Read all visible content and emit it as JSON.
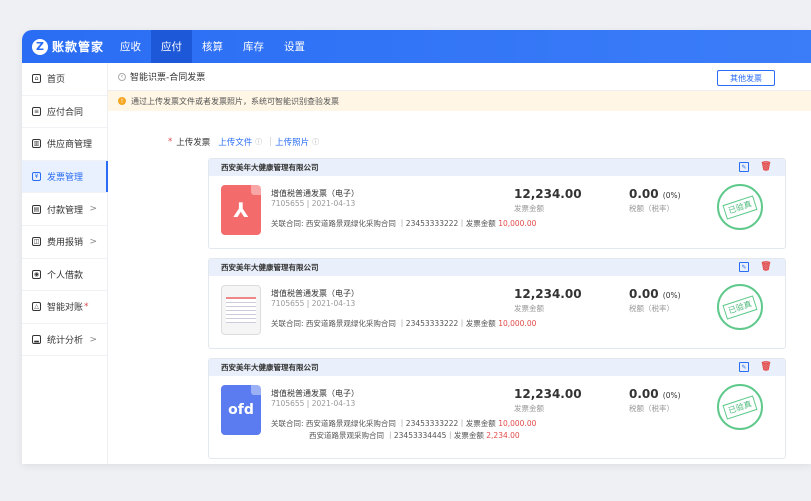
{
  "app": {
    "logo_char": "Z",
    "title": "账款管家"
  },
  "nav": [
    {
      "label": "应收",
      "active": false
    },
    {
      "label": "应付",
      "active": true
    },
    {
      "label": "核算",
      "active": false
    },
    {
      "label": "库存",
      "active": false
    },
    {
      "label": "设置",
      "active": false
    }
  ],
  "sidebar": {
    "items": [
      {
        "label": "首页",
        "icon": "home-icon"
      },
      {
        "label": "应付合同",
        "icon": "contract-icon"
      },
      {
        "label": "供应商管理",
        "icon": "supplier-icon"
      },
      {
        "label": "发票管理",
        "icon": "invoice-icon",
        "active": true
      },
      {
        "label": "付款管理",
        "icon": "payment-icon",
        "arrow": ">"
      },
      {
        "label": "费用报销",
        "icon": "expense-icon",
        "arrow": ">"
      },
      {
        "label": "个人借款",
        "icon": "loan-icon"
      },
      {
        "label": "智能对账",
        "icon": "reconcile-icon",
        "dot": "*"
      },
      {
        "label": "统计分析",
        "icon": "chart-icon",
        "arrow": ">"
      }
    ]
  },
  "breadcrumb": "智能识票-合同发票",
  "other_invoice_button": "其他发票",
  "notice": "通过上传发票文件或者发票照片，系统可智能识别查验发票",
  "upload": {
    "required_mark": "*",
    "label": "上传发票",
    "file_link": "上传文件",
    "separator": "|",
    "photo_link": "上传照片"
  },
  "invoices": [
    {
      "company": "西安美年大健康管理有限公司",
      "file_type": "pdf",
      "type_label": "",
      "title": "增值税普通发票（电子）",
      "meta": "7105655 | 2021-04-13",
      "related": [
        {
          "prefix": "关联合同:",
          "text": "西安道路景观绿化采购合同 ｜23453333222｜发票金额",
          "amount": "10,000.00"
        }
      ],
      "amount": "12,234.00",
      "amount_label": "发票金额",
      "tax": "0.00",
      "tax_rate": "(0%)",
      "tax_label": "税额（税率）",
      "stamp": "已验真"
    },
    {
      "company": "西安美年大健康管理有限公司",
      "file_type": "image",
      "type_label": "",
      "title": "增值税普通发票（电子）",
      "meta": "7105655 | 2021-04-13",
      "related": [
        {
          "prefix": "关联合同:",
          "text": "西安道路景观绿化采购合同 ｜23453333222｜发票金额",
          "amount": "10,000.00"
        }
      ],
      "amount": "12,234.00",
      "amount_label": "发票金额",
      "tax": "0.00",
      "tax_rate": "(0%)",
      "tax_label": "税额（税率）",
      "stamp": "已验真"
    },
    {
      "company": "西安美年大健康管理有限公司",
      "file_type": "ofd",
      "type_label": "ofd",
      "title": "增值税普通发票（电子）",
      "meta": "7105655 | 2021-04-13",
      "related": [
        {
          "prefix": "关联合同:",
          "text": "西安道路景观绿化采购合同 ｜23453333222｜发票金额",
          "amount": "10,000.00"
        },
        {
          "prefix": "",
          "text": "西安道路景观采购合同 ｜23453334445｜发票金额",
          "amount": "2,234.00"
        }
      ],
      "amount": "12,234.00",
      "amount_label": "发票金额",
      "tax": "0.00",
      "tax_rate": "(0%)",
      "tax_label": "税额（税率）",
      "stamp": "已验真"
    }
  ]
}
